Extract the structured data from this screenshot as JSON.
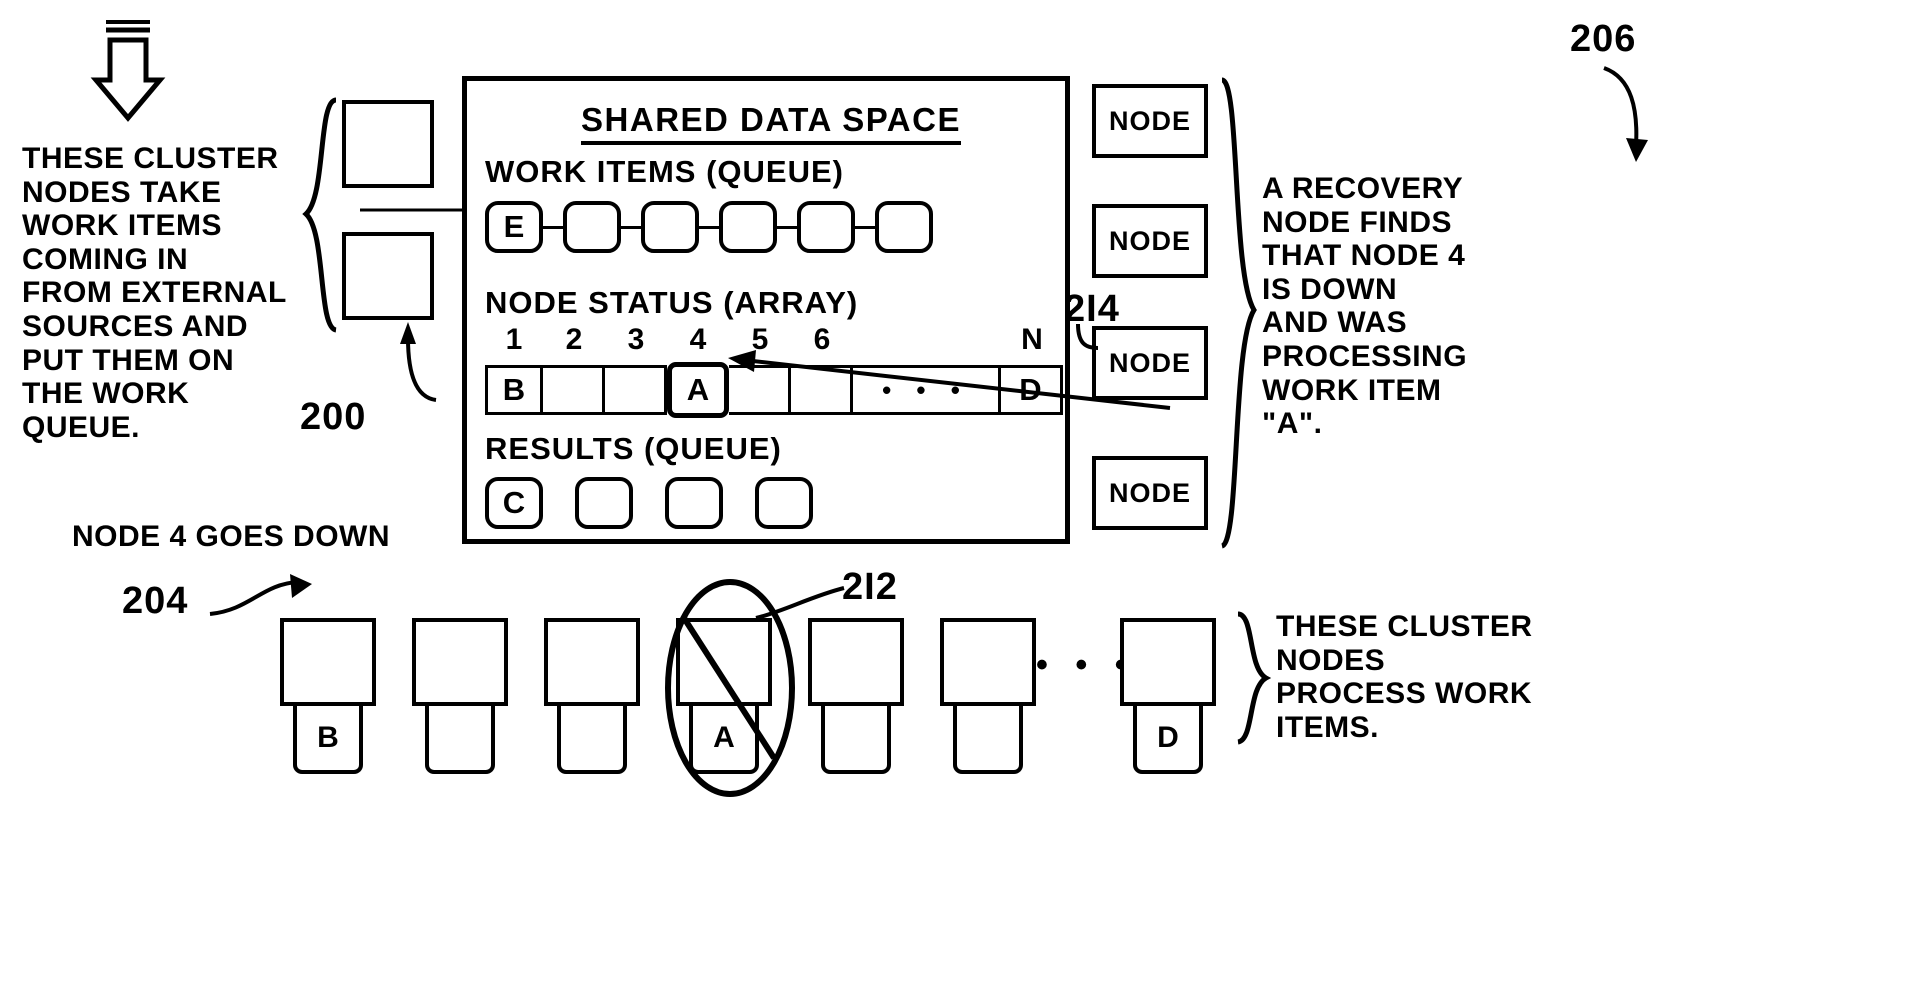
{
  "figure": {
    "left_note": {
      "lines": "THESE CLUSTER\nNODES TAKE\nWORK ITEMS\nCOMING IN\nFROM EXTERNAL\nSOURCES AND\nPUT THEM ON\nTHE WORK\nQUEUE."
    },
    "right_note": {
      "lines": "A RECOVERY\nNODE FINDS\nTHAT NODE 4\nIS DOWN\nAND WAS\nPROCESSING\nWORK ITEM\n\"A\"."
    },
    "bottom_right_note": {
      "lines": "THESE CLUSTER\nNODES\nPROCESS WORK\nITEMS."
    },
    "node_down_caption": "NODE 4 GOES DOWN",
    "reference_numerals": {
      "n200": "200",
      "n204": "204",
      "n206": "206",
      "n212": "2I2",
      "n214": "2I4"
    }
  },
  "shared_data_space": {
    "title": "SHARED DATA SPACE",
    "work_items": {
      "label": "WORK ITEMS (QUEUE)",
      "cells": [
        "E",
        "",
        "",
        "",
        "",
        ""
      ]
    },
    "node_status": {
      "label": "NODE STATUS (ARRAY)",
      "index_labels": [
        "1",
        "2",
        "3",
        "4",
        "5",
        "6"
      ],
      "last_index_label": "N",
      "cells": [
        "B",
        "",
        "",
        "A",
        "",
        "",
        "• • •",
        "D"
      ],
      "highlighted_index": 3
    },
    "results": {
      "label": "RESULTS (QUEUE)",
      "cells": [
        "C",
        "",
        "",
        ""
      ]
    }
  },
  "recovery_nodes": {
    "labels": [
      "NODE",
      "NODE",
      "NODE",
      "NODE"
    ]
  },
  "cluster_nodes": {
    "labels": [
      "B",
      "",
      "",
      "A",
      "",
      "",
      "D"
    ],
    "ellipsis": "• • •",
    "failed_index": 3
  }
}
